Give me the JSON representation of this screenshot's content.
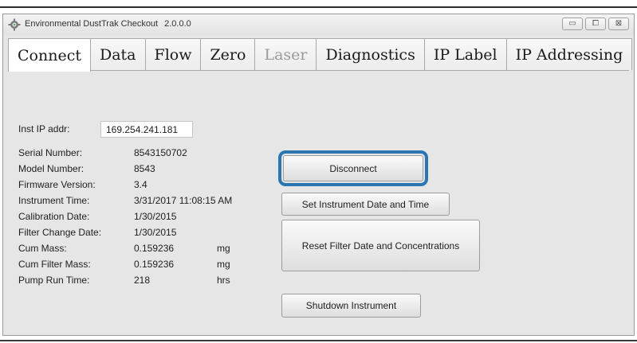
{
  "window": {
    "title": "Environmental DustTrak Checkout",
    "version": "2.0.0.0",
    "controls": {
      "minimize": "▭",
      "maximize": "⧠",
      "close": "⊠"
    }
  },
  "tabs": [
    {
      "label": "Connect",
      "state": "active"
    },
    {
      "label": "Data",
      "state": "normal"
    },
    {
      "label": "Flow",
      "state": "normal"
    },
    {
      "label": "Zero",
      "state": "normal"
    },
    {
      "label": "Laser",
      "state": "disabled"
    },
    {
      "label": "Diagnostics",
      "state": "normal"
    },
    {
      "label": "IP Label",
      "state": "normal"
    },
    {
      "label": "IP Addressing",
      "state": "normal"
    }
  ],
  "connect": {
    "ip_label": "Inst IP addr:",
    "ip_value": "169.254.241.181",
    "disconnect_button": "Disconnect",
    "set_time_button": "Set Instrument Date and Time",
    "reset_filter_button": "Reset Filter Date and Concentrations",
    "shutdown_button": "Shutdown Instrument",
    "fields": [
      {
        "label": "Serial Number:",
        "value": "8543150702",
        "unit": ""
      },
      {
        "label": "Model Number:",
        "value": "8543",
        "unit": ""
      },
      {
        "label": "Firmware Version:",
        "value": "3.4",
        "unit": ""
      },
      {
        "label": "Instrument Time:",
        "value": "3/31/2017 11:08:15 AM",
        "unit": ""
      },
      {
        "label": "Calibration Date:",
        "value": "1/30/2015",
        "unit": ""
      },
      {
        "label": "Filter Change Date:",
        "value": "1/30/2015",
        "unit": ""
      },
      {
        "label": "Cum Mass:",
        "value": "0.159236",
        "unit": "mg"
      },
      {
        "label": "Cum Filter Mass:",
        "value": "0.159236",
        "unit": "mg"
      },
      {
        "label": "Pump Run Time:",
        "value": "218",
        "unit": "hrs"
      }
    ]
  },
  "colors": {
    "focus_ring": "#2b76b2",
    "panel_bg": "#e6e6e6",
    "disabled_text": "#9b9b9b"
  }
}
